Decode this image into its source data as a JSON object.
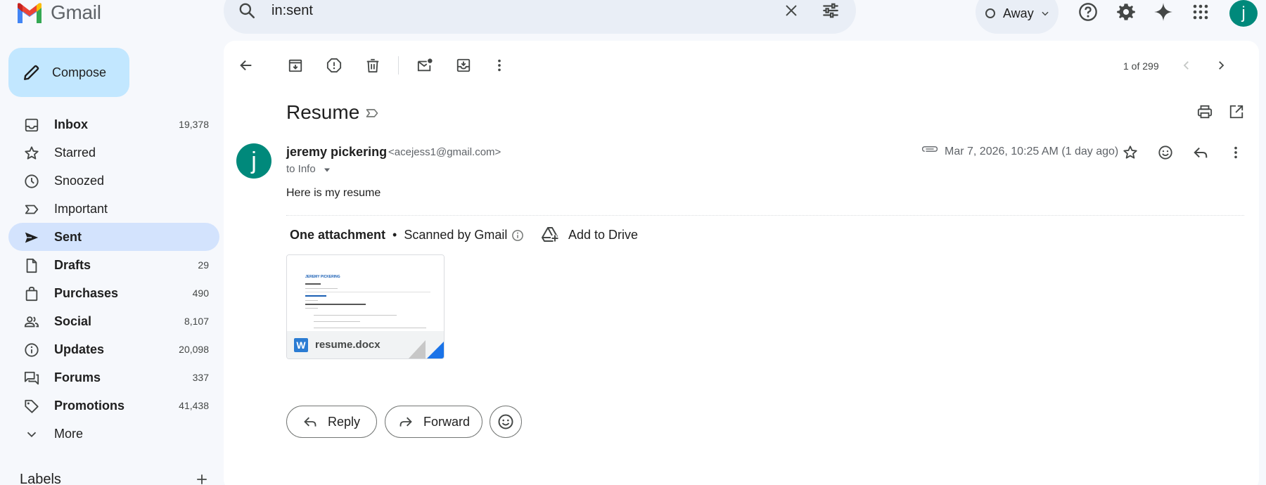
{
  "header": {
    "app_name": "Gmail",
    "search_value": "in:sent",
    "status_label": "Away",
    "avatar_initial": "j",
    "brand_colors": {
      "red": "#ea4335",
      "blue": "#4285f4",
      "green": "#34a853",
      "yellow": "#fbbc04"
    },
    "icons": [
      "search-icon",
      "clear-icon",
      "search-options-icon",
      "help-icon",
      "settings-icon",
      "gemini-icon",
      "apps-icon"
    ]
  },
  "sidebar": {
    "compose_label": "Compose",
    "items": [
      {
        "label": "Inbox",
        "count": "19,378",
        "bold": true,
        "icon": "inbox-icon"
      },
      {
        "label": "Starred",
        "count": "",
        "bold": false,
        "icon": "star-icon"
      },
      {
        "label": "Snoozed",
        "count": "",
        "bold": false,
        "icon": "clock-icon"
      },
      {
        "label": "Important",
        "count": "",
        "bold": false,
        "icon": "important-icon"
      },
      {
        "label": "Sent",
        "count": "",
        "bold": true,
        "icon": "send-icon",
        "active": true
      },
      {
        "label": "Drafts",
        "count": "29",
        "bold": true,
        "icon": "draft-icon"
      },
      {
        "label": "Purchases",
        "count": "490",
        "bold": true,
        "icon": "bag-icon"
      },
      {
        "label": "Social",
        "count": "8,107",
        "bold": true,
        "icon": "people-icon"
      },
      {
        "label": "Updates",
        "count": "20,098",
        "bold": true,
        "icon": "info-icon"
      },
      {
        "label": "Forums",
        "count": "337",
        "bold": true,
        "icon": "forum-icon"
      },
      {
        "label": "Promotions",
        "count": "41,438",
        "bold": true,
        "icon": "tag-icon"
      },
      {
        "label": "More",
        "count": "",
        "bold": false,
        "icon": "chevron-down-icon"
      }
    ],
    "labels_heading": "Labels"
  },
  "toolbar": {
    "pager": "1 of 299"
  },
  "message": {
    "subject": "Resume",
    "sender_name": "jeremy pickering",
    "sender_email": "<acejess1@gmail.com>",
    "sender_initial": "j",
    "to_line": "to Info",
    "date": "Mar 7, 2026, 10:25 AM (1 day ago)",
    "body": "Here is my resume",
    "attachment_heading": "One attachment",
    "attachment_separator": "•",
    "scanned": "Scanned by Gmail",
    "add_to_drive": "Add to Drive",
    "attachment_name": "resume.docx",
    "attachment_type_letter": "W",
    "preview_title": "JEREMY PICKERING",
    "reply_label": "Reply",
    "forward_label": "Forward"
  }
}
